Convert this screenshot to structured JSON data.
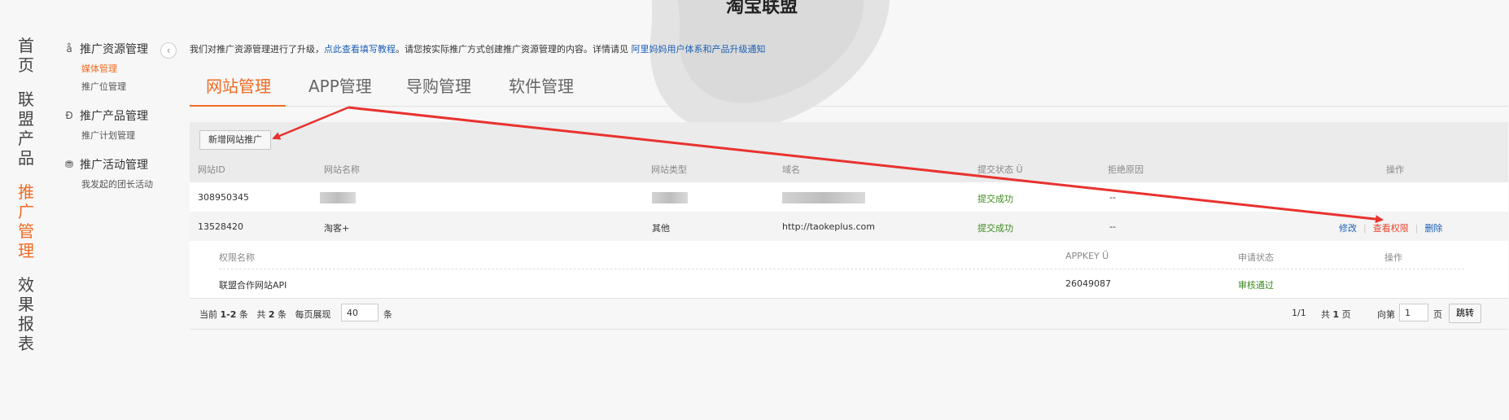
{
  "header": {
    "title": "淘宝联盟"
  },
  "main_nav": [
    {
      "label": "首页",
      "active": false
    },
    {
      "label": "联盟产品",
      "active": false
    },
    {
      "label": "推广管理",
      "active": true
    },
    {
      "label": "效果报表",
      "active": false
    }
  ],
  "sub_nav": {
    "groups": [
      {
        "glyph": "å",
        "title": "推广资源管理",
        "items": [
          {
            "label": "媒体管理",
            "active": true
          },
          {
            "label": "推广位管理",
            "active": false
          }
        ]
      },
      {
        "glyph": "Ð",
        "title": "推广产品管理",
        "items": [
          {
            "label": "推广计划管理",
            "active": false
          }
        ]
      },
      {
        "glyph": "⛃",
        "title": "推广活动管理",
        "items": [
          {
            "label": "我发起的团长活动",
            "active": false
          }
        ]
      }
    ],
    "collapse_glyph": "‹"
  },
  "notice": {
    "text1": "我们对推广资源管理进行了升级，",
    "link1": "点此查看填写教程",
    "text2": "。请您按实际推广方式创建推广资源管理的内容。详情请见",
    "link2": "阿里妈妈用户体系和产品升级通知"
  },
  "tabs": [
    {
      "label": "网站管理",
      "active": true
    },
    {
      "label": "APP管理",
      "active": false
    },
    {
      "label": "导购管理",
      "active": false
    },
    {
      "label": "软件管理",
      "active": false
    }
  ],
  "toolbar": {
    "add_label": "新增网站推广"
  },
  "table": {
    "headers": {
      "id": "网站ID",
      "name": "网站名称",
      "type": "网站类型",
      "domain": "域名",
      "status": "提交状态 Ü",
      "reason": "拒绝原因",
      "ops": "操作"
    },
    "rows": [
      {
        "id": "308950345",
        "name": "",
        "type": "",
        "domain": "",
        "status": "提交成功",
        "reason": "--"
      },
      {
        "id": "13528420",
        "name": "淘客+",
        "type": "其他",
        "domain": "http://taokeplus.com",
        "status": "提交成功",
        "reason": "--"
      }
    ],
    "ops": {
      "edit": "修改",
      "view": "查看权限",
      "delete": "删除"
    }
  },
  "permission_table": {
    "headers": {
      "name": "权限名称",
      "appkey": "APPKEY Ü",
      "status": "申请状态",
      "ops": "操作"
    },
    "rows": [
      {
        "name": "联盟合作网站API",
        "appkey": "26049087",
        "status": "审核通过"
      }
    ]
  },
  "pager": {
    "current_label": "当前",
    "range": "1-2",
    "unit1": "条",
    "total_label": "共",
    "total": "2",
    "unit2": "条",
    "per_page_label": "每页展现",
    "per_page": "40",
    "unit3": "条",
    "page_info": "1/1",
    "pages_label": "共",
    "pages": "1",
    "pages_unit": "页",
    "goto_label": "向第",
    "goto_value": "1",
    "goto_unit": "页",
    "jump_label": "跳转"
  },
  "colors": {
    "accent": "#f06b22",
    "link": "#1b5fb4",
    "success": "#3d8b1f",
    "annotation": "#e8322e"
  }
}
